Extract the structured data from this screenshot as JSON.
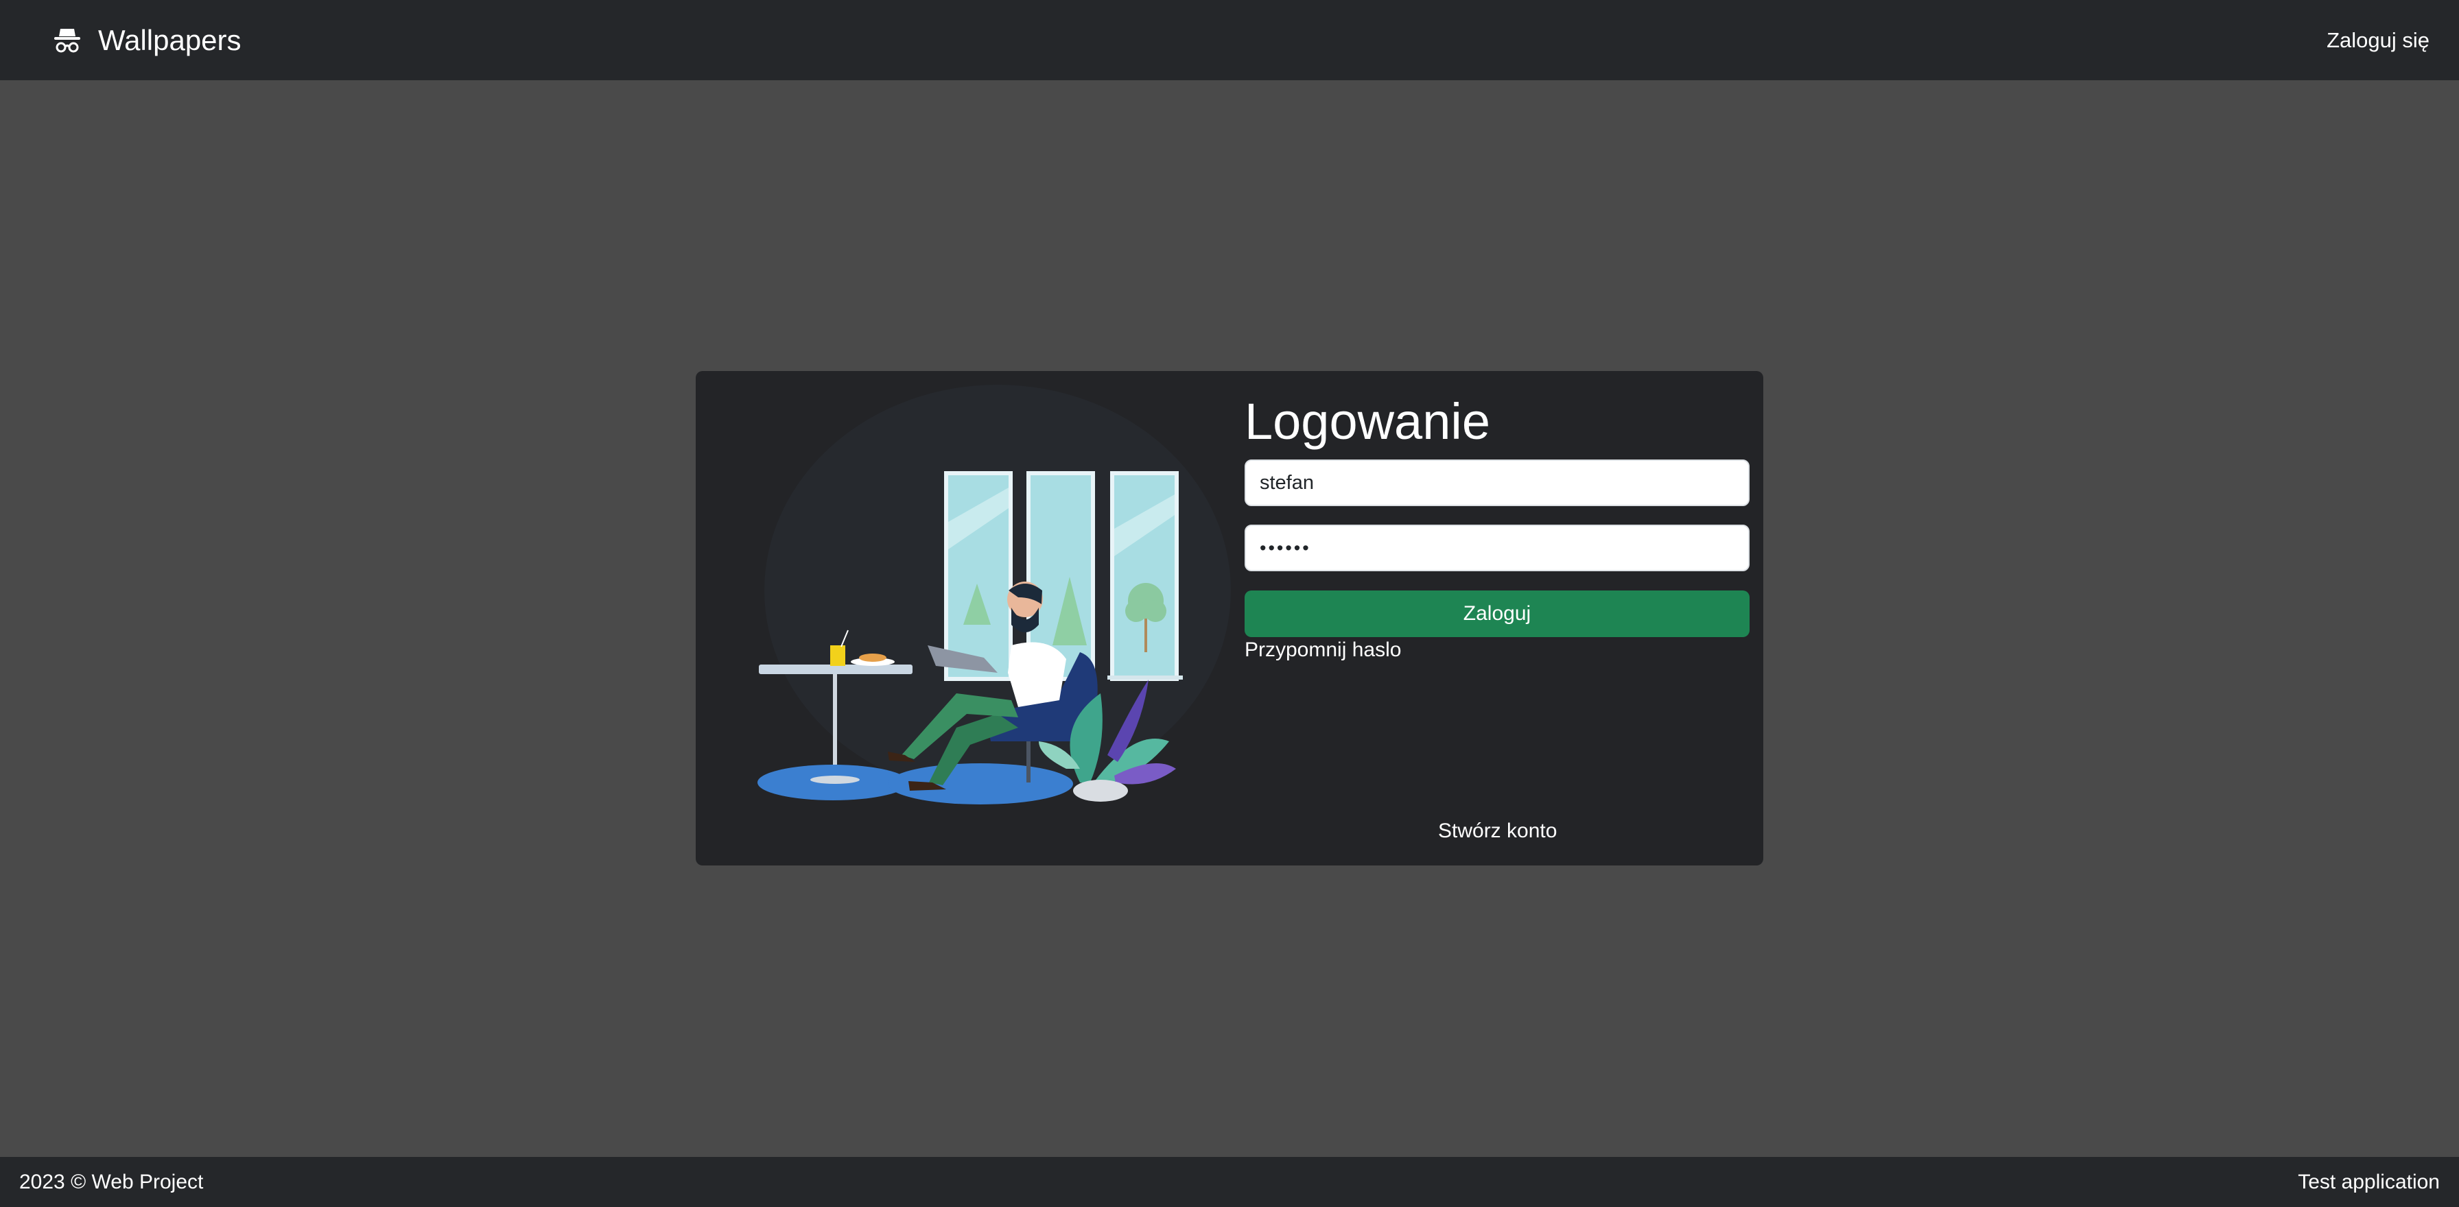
{
  "navbar": {
    "brand_icon": "incognito-icon",
    "brand_title": "Wallpapers",
    "login_link": "Zaloguj się"
  },
  "login_card": {
    "title": "Logowanie",
    "username_value": "stefan",
    "password_value": "••••••",
    "submit_label": "Zaloguj",
    "remind_password_link": "Przypomnij haslo",
    "create_account_link": "Stwórz konto",
    "illustration": "person-in-armchair-with-laptop-illustration"
  },
  "footer": {
    "copyright": "2023 © Web Project",
    "right_text": "Test application"
  },
  "colors": {
    "page_background": "#4a4a4a",
    "navbar_background": "#25272a",
    "card_background": "#232427",
    "submit_button": "#1e8553"
  }
}
